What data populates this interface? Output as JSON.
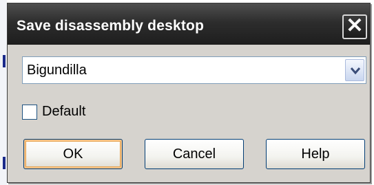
{
  "dialog": {
    "title": "Save disassembly desktop",
    "close_label": "✕"
  },
  "combo": {
    "value": "Bigundilla",
    "arrow_icon": "chevron-down-icon"
  },
  "checkbox": {
    "label": "Default",
    "checked": false
  },
  "buttons": {
    "ok": "OK",
    "cancel": "Cancel",
    "help": "Help"
  },
  "colors": {
    "titlebar": "#2d2d2d",
    "dialog_face": "#d6d3ce",
    "default_button_ring": "#e6a24e"
  }
}
